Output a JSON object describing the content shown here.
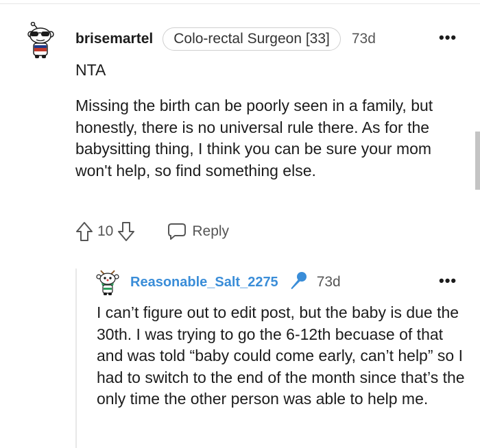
{
  "comment": {
    "username": "brisemartel",
    "flair": "Colo-rectal Surgeon [33]",
    "age": "73d",
    "more_label": "•••",
    "first_line": "NTA",
    "body": "Missing the birth can be poorly seen in a family, but honestly, there is no universal rule there. As for the babysitting thing, I think you can be sure your mom won't help, so find something else.",
    "votes": "10",
    "reply_label": "Reply"
  },
  "reply": {
    "username": "Reasonable_Salt_2275",
    "badge_icon": "microphone-icon",
    "age": "73d",
    "more_label": "•••",
    "body": "I can’t figure out to edit post, but the baby is due the 30th. I was trying to go the 6-12th becuase of that and was told “baby could come early, can’t help” so I had to switch to the end of the month since that’s the only time the other person was able to help me."
  },
  "colors": {
    "op_username": "#3a8dd8",
    "text": "#1c1c1c",
    "meta": "#555555"
  }
}
